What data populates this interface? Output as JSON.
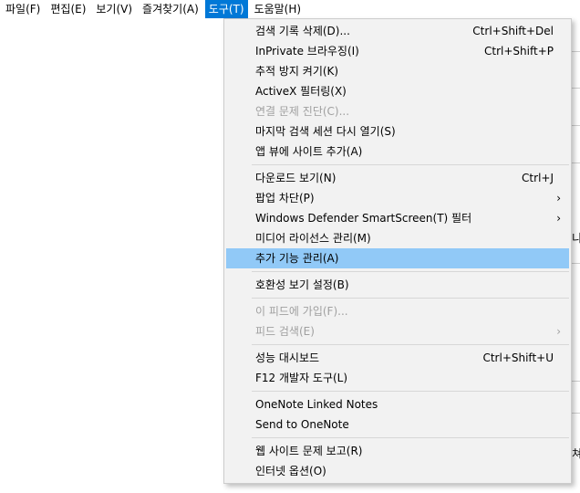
{
  "menubar": {
    "items": [
      {
        "label": "파일(F)"
      },
      {
        "label": "편집(E)"
      },
      {
        "label": "보기(V)"
      },
      {
        "label": "즐겨찾기(A)"
      },
      {
        "label": "도구(T)"
      },
      {
        "label": "도움말(H)"
      }
    ]
  },
  "tools_menu": {
    "items": [
      {
        "label": "검색 기록 삭제(D)...",
        "shortcut": "Ctrl+Shift+Del"
      },
      {
        "label": "InPrivate 브라우징(I)",
        "shortcut": "Ctrl+Shift+P"
      },
      {
        "label": "추적 방지 켜기(K)"
      },
      {
        "label": "ActiveX 필터링(X)"
      },
      {
        "label": "연결 문제 진단(C)..."
      },
      {
        "label": "마지막 검색 세션 다시 열기(S)"
      },
      {
        "label": "앱 뷰에 사이트 추가(A)"
      },
      {
        "label": "다운로드 보기(N)",
        "shortcut": "Ctrl+J"
      },
      {
        "label": "팝업 차단(P)",
        "arrow": "›"
      },
      {
        "label": "Windows Defender SmartScreen(T) 필터",
        "arrow": "›"
      },
      {
        "label": "미디어 라이선스 관리(M)"
      },
      {
        "label": "추가 기능 관리(A)"
      },
      {
        "label": "호환성 보기 설정(B)"
      },
      {
        "label": "이 피드에 가입(F)..."
      },
      {
        "label": "피드 검색(E)",
        "arrow": "›"
      },
      {
        "label": "성능 대시보드",
        "shortcut": "Ctrl+Shift+U"
      },
      {
        "label": "F12 개발자 도구(L)"
      },
      {
        "label": "OneNote Linked Notes"
      },
      {
        "label": "Send to OneNote"
      },
      {
        "label": "웹 사이트 문제 보고(R)"
      },
      {
        "label": "인터넷 옵션(O)"
      }
    ]
  },
  "background": {
    "fragment_1": "니",
    "fragment_2": "쳐"
  }
}
